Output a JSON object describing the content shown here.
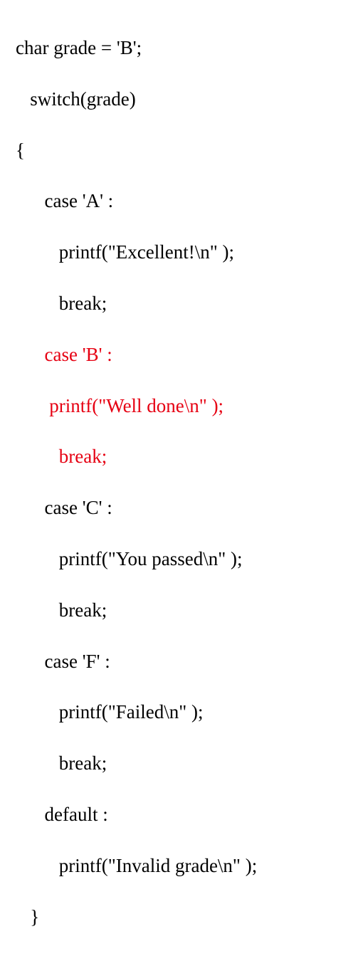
{
  "code": {
    "lines": [
      {
        "text": "char grade = 'B';",
        "indent": 0,
        "highlight": false
      },
      {
        "text": "switch(grade)",
        "indent": 1,
        "highlight": false
      },
      {
        "text": "{",
        "indent": 0,
        "highlight": false
      },
      {
        "text": "case 'A' :",
        "indent": 2,
        "highlight": false
      },
      {
        "text": "printf(\"Excellent!\\n\" );",
        "indent": 3,
        "highlight": false
      },
      {
        "text": "break;",
        "indent": 3,
        "highlight": false
      },
      {
        "text": "case 'B' :",
        "indent": 2,
        "highlight": true
      },
      {
        "text": " printf(\"Well done\\n\" );",
        "indent": 2,
        "highlight": true
      },
      {
        "text": "break;",
        "indent": 3,
        "highlight": true
      },
      {
        "text": "case 'C' :",
        "indent": 2,
        "highlight": false
      },
      {
        "text": "printf(\"You passed\\n\" );",
        "indent": 3,
        "highlight": false
      },
      {
        "text": "break;",
        "indent": 3,
        "highlight": false
      },
      {
        "text": "case 'F' :",
        "indent": 2,
        "highlight": false
      },
      {
        "text": "printf(\"Failed\\n\" );",
        "indent": 3,
        "highlight": false
      },
      {
        "text": "break;",
        "indent": 3,
        "highlight": false
      },
      {
        "text": "default :",
        "indent": 2,
        "highlight": false
      },
      {
        "text": "printf(\"Invalid grade\\n\" );",
        "indent": 3,
        "highlight": false
      },
      {
        "text": "}",
        "indent": 1,
        "highlight": false
      }
    ],
    "indent_unit": "   "
  }
}
